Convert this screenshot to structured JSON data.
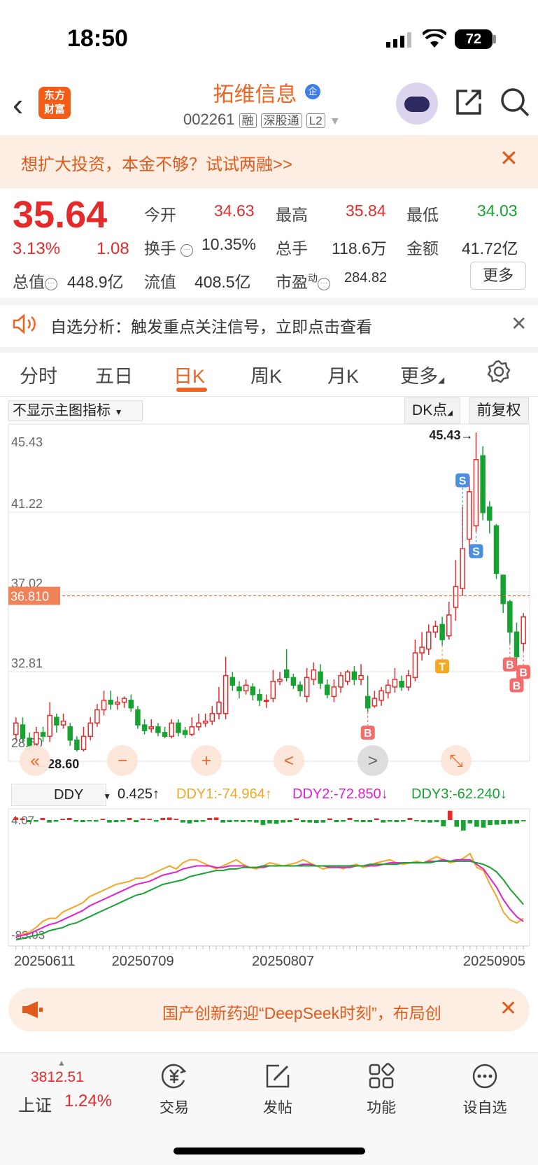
{
  "status_bar": {
    "time": "18:50",
    "battery": "72"
  },
  "header": {
    "logo_line1": "东方",
    "logo_line2": "财富",
    "stock_name": "拓维信息",
    "badge": "企",
    "code": "002261",
    "tag1": "融",
    "tag2": "深股通",
    "tag3": "L2"
  },
  "promo": {
    "text": "想扩大投资，本金不够？试试两融>>"
  },
  "quote": {
    "price": "35.64",
    "change_pct": "3.13%",
    "change_val": "1.08",
    "open_label": "今开",
    "open": "34.63",
    "high_label": "最高",
    "high": "35.84",
    "low_label": "最低",
    "low": "34.03",
    "turnover_label": "换手",
    "turnover": "10.35%",
    "volume_label": "总手",
    "volume": "118.6万",
    "amount_label": "金额",
    "amount": "41.72亿",
    "mktcap_label": "总值",
    "mktcap": "448.9亿",
    "float_label": "流值",
    "float": "408.5亿",
    "pe_label": "市盈",
    "pe_sup": "动",
    "pe": "284.82",
    "more": "更多"
  },
  "alert": {
    "text": "自选分析：触发重点关注信号，立即点击查看"
  },
  "tabs": [
    "分时",
    "五日",
    "日K",
    "周K",
    "月K",
    "更多"
  ],
  "active_tab": 2,
  "chart_controls": {
    "indicator": "不显示主图指标",
    "dk": "DK点",
    "adjust": "前复权"
  },
  "colors": {
    "up": "#e42a2a",
    "down": "#16a331",
    "accent": "#f06320"
  },
  "chart_data": [
    {
      "type": "candlestick",
      "ylim": [
        28.6,
        45.43
      ],
      "y_ticks": [
        "45.43",
        "41.22",
        "37.02",
        "32.81",
        "28.60"
      ],
      "current_price_label": "36.810",
      "max_label": "45.43→",
      "min_label": "←28.60",
      "candles": [
        [
          29.5,
          30.1,
          29.2,
          30.4
        ],
        [
          30.0,
          29.3,
          29.1,
          30.4
        ],
        [
          29.3,
          28.9,
          28.6,
          29.6
        ],
        [
          29.0,
          29.6,
          28.8,
          29.9
        ],
        [
          29.6,
          29.4,
          29.1,
          29.9
        ],
        [
          29.4,
          30.5,
          29.1,
          31.2
        ],
        [
          30.4,
          30.0,
          29.6,
          30.6
        ],
        [
          30.0,
          30.2,
          29.8,
          30.6
        ],
        [
          29.9,
          29.2,
          28.9,
          30.1
        ],
        [
          29.2,
          28.7,
          28.6,
          29.4
        ],
        [
          28.7,
          29.4,
          28.6,
          29.9
        ],
        [
          29.4,
          30.1,
          29.2,
          30.4
        ],
        [
          30.1,
          30.8,
          29.9,
          31.1
        ],
        [
          30.8,
          31.3,
          30.5,
          31.8
        ],
        [
          31.3,
          31.1,
          30.8,
          31.8
        ],
        [
          31.1,
          31.2,
          30.8,
          31.5
        ],
        [
          31.2,
          31.4,
          30.9,
          31.5
        ],
        [
          31.3,
          30.9,
          30.7,
          31.6
        ],
        [
          30.8,
          30.0,
          29.8,
          31.0
        ],
        [
          30.0,
          29.7,
          29.5,
          30.3
        ],
        [
          29.8,
          29.9,
          29.6,
          30.3
        ],
        [
          29.9,
          29.6,
          29.4,
          30.1
        ],
        [
          29.6,
          29.4,
          29.3,
          29.9
        ],
        [
          29.4,
          30.1,
          29.3,
          30.3
        ],
        [
          30.1,
          29.6,
          29.4,
          30.3
        ],
        [
          29.7,
          29.5,
          29.3,
          29.9
        ],
        [
          29.5,
          29.9,
          29.4,
          30.4
        ],
        [
          29.9,
          30.1,
          29.7,
          30.6
        ],
        [
          30.1,
          30.2,
          29.9,
          30.6
        ],
        [
          30.2,
          30.6,
          30.0,
          31.0
        ],
        [
          30.6,
          31.2,
          30.3,
          32.0
        ],
        [
          30.6,
          32.6,
          30.3,
          33.6
        ],
        [
          32.5,
          32.1,
          31.8,
          32.8
        ],
        [
          32.0,
          31.8,
          31.4,
          32.3
        ],
        [
          31.8,
          32.1,
          31.6,
          32.4
        ],
        [
          32.0,
          31.6,
          31.3,
          32.2
        ],
        [
          31.6,
          31.3,
          31.0,
          31.9
        ],
        [
          31.3,
          31.3,
          30.9,
          31.6
        ],
        [
          31.4,
          32.3,
          31.2,
          32.9
        ],
        [
          32.3,
          32.4,
          32.1,
          32.8
        ],
        [
          32.9,
          32.5,
          32.3,
          34.0
        ],
        [
          32.5,
          32.1,
          31.9,
          32.7
        ],
        [
          32.1,
          31.8,
          31.5,
          32.3
        ],
        [
          31.5,
          32.5,
          31.2,
          33.0
        ],
        [
          32.4,
          32.9,
          32.1,
          33.3
        ],
        [
          32.8,
          32.2,
          31.9,
          33.2
        ],
        [
          32.1,
          31.6,
          31.4,
          32.4
        ],
        [
          31.5,
          32.0,
          31.2,
          32.4
        ],
        [
          32.0,
          32.6,
          31.7,
          32.8
        ],
        [
          32.3,
          32.8,
          32.1,
          32.9
        ],
        [
          32.8,
          32.4,
          32.1,
          33.1
        ],
        [
          32.4,
          32.6,
          32.1,
          33.2
        ],
        [
          31.5,
          30.9,
          30.7,
          32.6
        ],
        [
          31.0,
          31.4,
          30.9,
          31.8
        ],
        [
          31.3,
          31.8,
          31.0,
          32.0
        ],
        [
          31.7,
          32.1,
          31.4,
          32.4
        ],
        [
          32.0,
          32.4,
          31.7,
          33.0
        ],
        [
          32.3,
          32.0,
          31.8,
          32.6
        ],
        [
          32.0,
          32.6,
          31.8,
          32.9
        ],
        [
          32.5,
          33.8,
          32.3,
          34.5
        ],
        [
          33.8,
          34.1,
          33.4,
          34.9
        ],
        [
          34.0,
          34.9,
          33.7,
          35.3
        ],
        [
          34.9,
          35.2,
          34.6,
          35.5
        ],
        [
          35.3,
          34.5,
          34.2,
          35.7
        ],
        [
          34.7,
          35.8,
          34.5,
          36.5
        ],
        [
          36.2,
          37.3,
          35.5,
          38.7
        ],
        [
          37.2,
          39.3,
          36.8,
          41.5
        ],
        [
          39.8,
          42.3,
          39.0,
          43.1
        ],
        [
          40.5,
          44.0,
          40.2,
          45.43
        ],
        [
          44.2,
          41.2,
          40.8,
          44.7
        ],
        [
          41.5,
          40.8,
          40.1,
          41.8
        ],
        [
          40.5,
          38.0,
          37.7,
          40.6
        ],
        [
          37.9,
          36.4,
          35.9,
          37.9
        ],
        [
          36.5,
          34.9,
          34.3,
          36.6
        ],
        [
          34.9,
          33.6,
          33.2,
          35.4
        ],
        [
          34.3,
          35.7,
          33.9,
          35.9
        ]
      ],
      "buy_sell_markers": [
        {
          "label": "S",
          "index": 66
        },
        {
          "label": "S",
          "index": 68
        },
        {
          "label": "B",
          "index": 52
        },
        {
          "label": "T",
          "index": 63
        },
        {
          "label": "B",
          "index": 73
        },
        {
          "label": "B",
          "index": 74
        },
        {
          "label": "B",
          "index": 75
        }
      ]
    },
    {
      "type": "line",
      "indicator": "DDY",
      "y_ticks": [
        "4.07",
        "-83.03"
      ],
      "ylim": [
        -83.03,
        4.07
      ],
      "x_labels": [
        "20250611",
        "20250709",
        "20250807",
        "20250905"
      ],
      "x_label_index": [
        0,
        19,
        40,
        63
      ],
      "ddy_value": "0.425↑",
      "series": [
        {
          "name": "DDY1:-74.964↑",
          "color": "#f5a623",
          "values": [
            -78,
            -76,
            -75,
            -72,
            -68,
            -66,
            -66,
            -62,
            -60,
            -58,
            -56,
            -52,
            -50,
            -48,
            -46,
            -44,
            -43,
            -42,
            -40,
            -40,
            -38,
            -36,
            -34,
            -32,
            -34,
            -30,
            -28,
            -28,
            -30,
            -32,
            -34,
            -32,
            -30,
            -28,
            -31,
            -33,
            -34,
            -32,
            -30,
            -31,
            -32,
            -31,
            -30,
            -28,
            -30,
            -32,
            -34,
            -33,
            -32,
            -34,
            -32,
            -31,
            -33,
            -32,
            -30,
            -29,
            -28,
            -30,
            -31,
            -30,
            -29,
            -30,
            -28,
            -26,
            -28,
            -30,
            -29,
            -27,
            -24,
            -33,
            -35,
            -44,
            -52,
            -62,
            -67,
            -69,
            -66
          ]
        },
        {
          "name": "DDY2:-72.850↓",
          "color": "#e020d0",
          "values": [
            -78,
            -77,
            -76,
            -74,
            -72,
            -70,
            -69,
            -67,
            -65,
            -63,
            -61,
            -58,
            -56,
            -54,
            -52,
            -50,
            -48,
            -46,
            -44,
            -43,
            -42,
            -40,
            -38,
            -37,
            -36,
            -34,
            -33,
            -32,
            -32,
            -32,
            -33,
            -33,
            -32,
            -32,
            -32,
            -33,
            -33,
            -33,
            -32,
            -32,
            -32,
            -32,
            -32,
            -31,
            -31,
            -32,
            -32,
            -33,
            -33,
            -33,
            -33,
            -32,
            -32,
            -32,
            -32,
            -31,
            -30,
            -30,
            -30,
            -30,
            -30,
            -30,
            -29,
            -29,
            -28,
            -29,
            -28,
            -28,
            -28,
            -31,
            -34,
            -40,
            -46,
            -54,
            -60,
            -65,
            -68
          ]
        },
        {
          "name": "DDY3:-62.240↓",
          "color": "#16a331",
          "values": [
            -80,
            -79,
            -78,
            -77,
            -76,
            -74,
            -73,
            -72,
            -70,
            -69,
            -67,
            -65,
            -63,
            -61,
            -59,
            -57,
            -55,
            -53,
            -51,
            -50,
            -48,
            -46,
            -44,
            -43,
            -42,
            -41,
            -39,
            -38,
            -37,
            -36,
            -35,
            -35,
            -34,
            -34,
            -33,
            -33,
            -33,
            -32,
            -32,
            -32,
            -32,
            -32,
            -32,
            -32,
            -32,
            -32,
            -32,
            -32,
            -32,
            -32,
            -32,
            -32,
            -32,
            -31,
            -31,
            -31,
            -31,
            -31,
            -30,
            -30,
            -30,
            -30,
            -30,
            -29,
            -29,
            -29,
            -29,
            -29,
            -29,
            -30,
            -31,
            -33,
            -36,
            -41,
            -47,
            -52,
            -57
          ]
        }
      ],
      "histogram": [
        0.6,
        0.4,
        -0.5,
        -0.4,
        0.5,
        -0.6,
        -0.4,
        0.3,
        0.5,
        -0.4,
        -0.5,
        -0.3,
        -0.4,
        0.3,
        -0.6,
        -0.5,
        -0.4,
        0.5,
        -0.5,
        0.4,
        0.3,
        -0.4,
        0.5,
        0.6,
        0.3,
        -0.6,
        -0.8,
        -0.5,
        -0.4,
        0.5,
        0.6,
        -0.6,
        -0.5,
        -0.4,
        -0.5,
        -0.4,
        -0.6,
        -1.2,
        -0.8,
        -0.9,
        -0.6,
        -0.5,
        0.4,
        -0.5,
        -0.6,
        -0.7,
        -0.6,
        0.4,
        -0.5,
        -0.4,
        0.5,
        -0.4,
        -0.5,
        -0.5,
        0.4,
        -0.6,
        -0.4,
        -0.5,
        -0.4,
        0.5,
        -0.3,
        -0.5,
        -0.6,
        -0.5,
        -1.5,
        2.2,
        -1.6,
        -2.5,
        -0.8,
        -1.6,
        -1.8,
        -1.2,
        -1.1,
        -1.0,
        -0.9,
        -0.8,
        -0.3
      ]
    }
  ],
  "chart_nav": [
    "«",
    "−",
    "+",
    "<",
    ">",
    "⤡"
  ],
  "ticker": {
    "text": "国产创新药迎“DeepSeek时刻”，布局创"
  },
  "bottom": {
    "index_value": "3812.51",
    "index_name": "上证",
    "index_pct": "1.24%",
    "nav": [
      "交易",
      "发帖",
      "功能",
      "设自选"
    ]
  }
}
